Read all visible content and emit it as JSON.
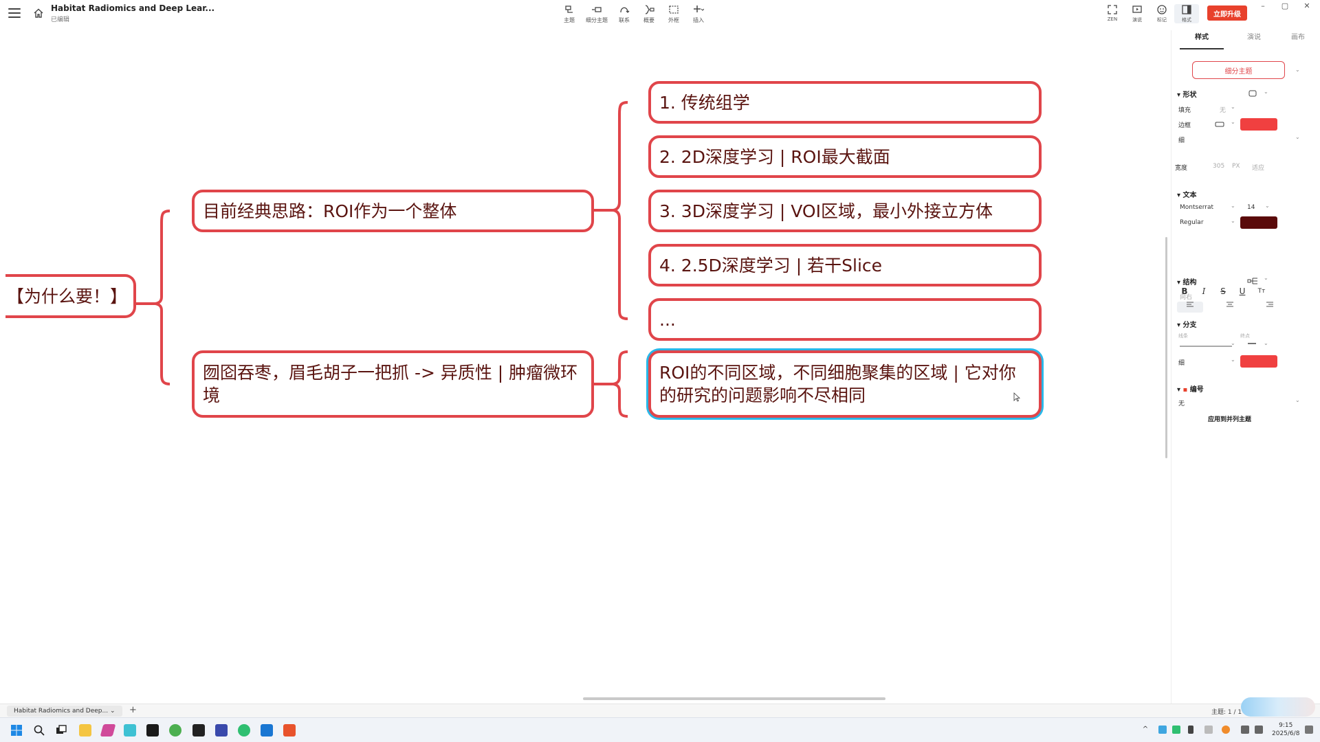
{
  "app": {
    "title": "Habitat Radiomics and Deep Lear...",
    "status": "已编辑"
  },
  "toolbar": [
    {
      "label": "主题",
      "icon": "topic-icon"
    },
    {
      "label": "细分主题",
      "icon": "subtopic-icon"
    },
    {
      "label": "联系",
      "icon": "relationship-icon"
    },
    {
      "label": "概要",
      "icon": "summary-icon"
    },
    {
      "label": "外框",
      "icon": "boundary-icon"
    },
    {
      "label": "插入",
      "icon": "insert-icon"
    }
  ],
  "right_tools": [
    {
      "label": "ZEN",
      "icon": "zen-mode-icon"
    },
    {
      "label": "演说",
      "icon": "pitch-icon"
    },
    {
      "label": "标记",
      "icon": "marker-icon"
    },
    {
      "label": "格式",
      "icon": "format-icon"
    }
  ],
  "upgrade_label": "立即升级",
  "window": {
    "minimize": "–",
    "maximize": "▢",
    "close": "✕"
  },
  "mindmap": {
    "root": "【为什么要！】",
    "branches": [
      {
        "text": "目前经典思路：ROI作为一个整体",
        "children": [
          "1. 传统组学",
          "2. 2D深度学习 | ROI最大截面",
          "3. 3D深度学习 | VOI区域，最小外接立方体",
          "4. 2.5D深度学习 | 若干Slice",
          "..."
        ]
      },
      {
        "text": "囫囵吞枣，眉毛胡子一把抓 -> 异质性 | 肿瘤微环境",
        "children": [
          "ROI的不同区域，不同细胞聚集的区域 | 它对你的研究的问题影响不尽相同"
        ]
      }
    ]
  },
  "panel": {
    "tabs": [
      "样式",
      "演说",
      "画布"
    ],
    "topic_button": "细分主题",
    "shape": {
      "title": "形状",
      "fill_label": "填充",
      "fill_value": "无",
      "border_label": "边框",
      "border_color": "#f04040",
      "border_weight": "细",
      "width_label": "宽度",
      "width_value": "305",
      "width_unit": "PX",
      "width_fit": "适应"
    },
    "text": {
      "title": "文本",
      "font": "Montserrat",
      "size": "14",
      "weight": "Regular",
      "color": "#5a0a0a",
      "bold": "B",
      "italic": "I",
      "strike": "S",
      "underline": "U",
      "case": "Tт"
    },
    "structure": {
      "title": "结构",
      "value": "向右"
    },
    "branch": {
      "title": "分支",
      "line_label": "线条",
      "end_label": "终点",
      "weight": "细",
      "color": "#f04040"
    },
    "numbering": {
      "title": "编号",
      "value": "无"
    },
    "apply_label": "应用到并列主题"
  },
  "sheet": {
    "tab": "Habitat Radiomics and Deep...",
    "add": "+",
    "topic_count": "主题: 1 / 1"
  },
  "clock": {
    "time": "9:15",
    "date": "2025/6/8"
  },
  "colors": {
    "node_border": "#e0454a",
    "node_text": "#5a1410",
    "selection": "#2ab7e8",
    "accent": "#e8412c"
  }
}
